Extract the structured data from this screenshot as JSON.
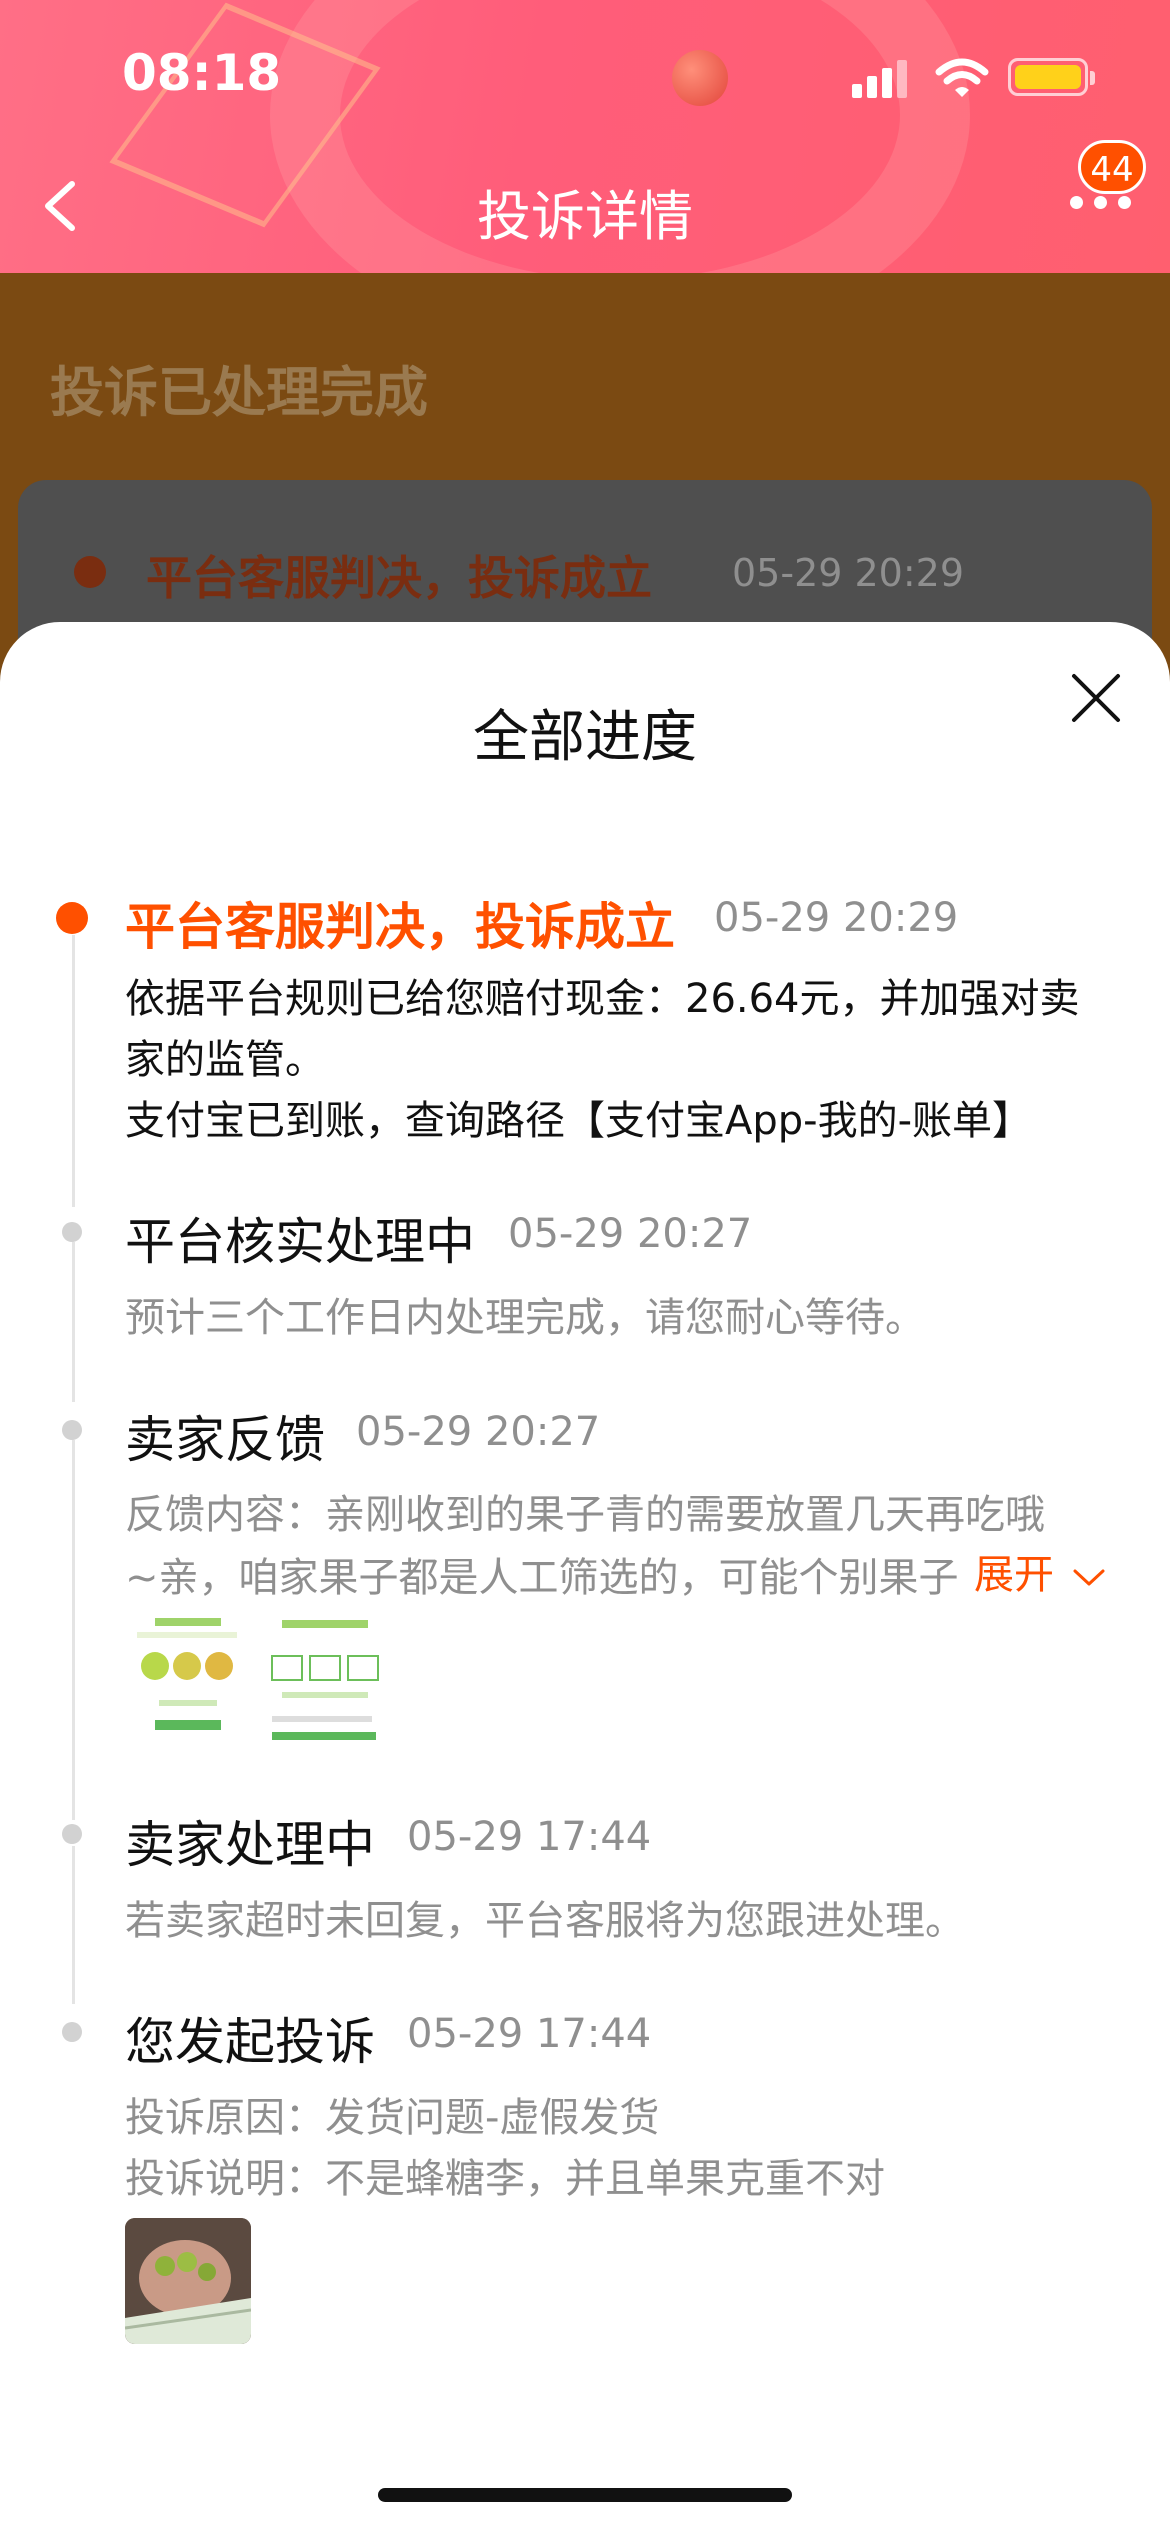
{
  "status_bar": {
    "time": "08:18"
  },
  "header": {
    "title": "投诉详情",
    "badge_count": "44"
  },
  "background_page": {
    "status_title": "投诉已处理完成",
    "latest_result": "平台客服判决，投诉成立",
    "latest_time": "05-29 20:29"
  },
  "sheet": {
    "title": "全部进度",
    "expand_label": "展开",
    "steps": [
      {
        "title": "平台客服判决，投诉成立",
        "time": "05-29 20:29",
        "lines": [
          "依据平台规则已给您赔付现金：26.64元，并加强对卖",
          "家的监管。",
          "支付宝已到账，查询路径【支付宝App-我的-账单】"
        ]
      },
      {
        "title": "平台核实处理中",
        "time": "05-29 20:27",
        "lines": [
          "预计三个工作日内处理完成，请您耐心等待。"
        ]
      },
      {
        "title": "卖家反馈",
        "time": "05-29 20:27",
        "lines": [
          "反馈内容：亲刚收到的果子青的需要放置几天再吃哦",
          "~亲，咱家果子都是人工筛选的，可能个别果子"
        ]
      },
      {
        "title": "卖家处理中",
        "time": "05-29 17:44",
        "lines": [
          "若卖家超时未回复，平台客服将为您跟进处理。"
        ]
      },
      {
        "title": "您发起投诉",
        "time": "05-29 17:44",
        "lines": [
          "投诉原因：发货问题-虚假发货",
          "投诉说明：不是蜂糖李，并且单果克重不对"
        ]
      }
    ]
  },
  "colors": {
    "accent": "#ff5000",
    "header": "#ff6680"
  }
}
